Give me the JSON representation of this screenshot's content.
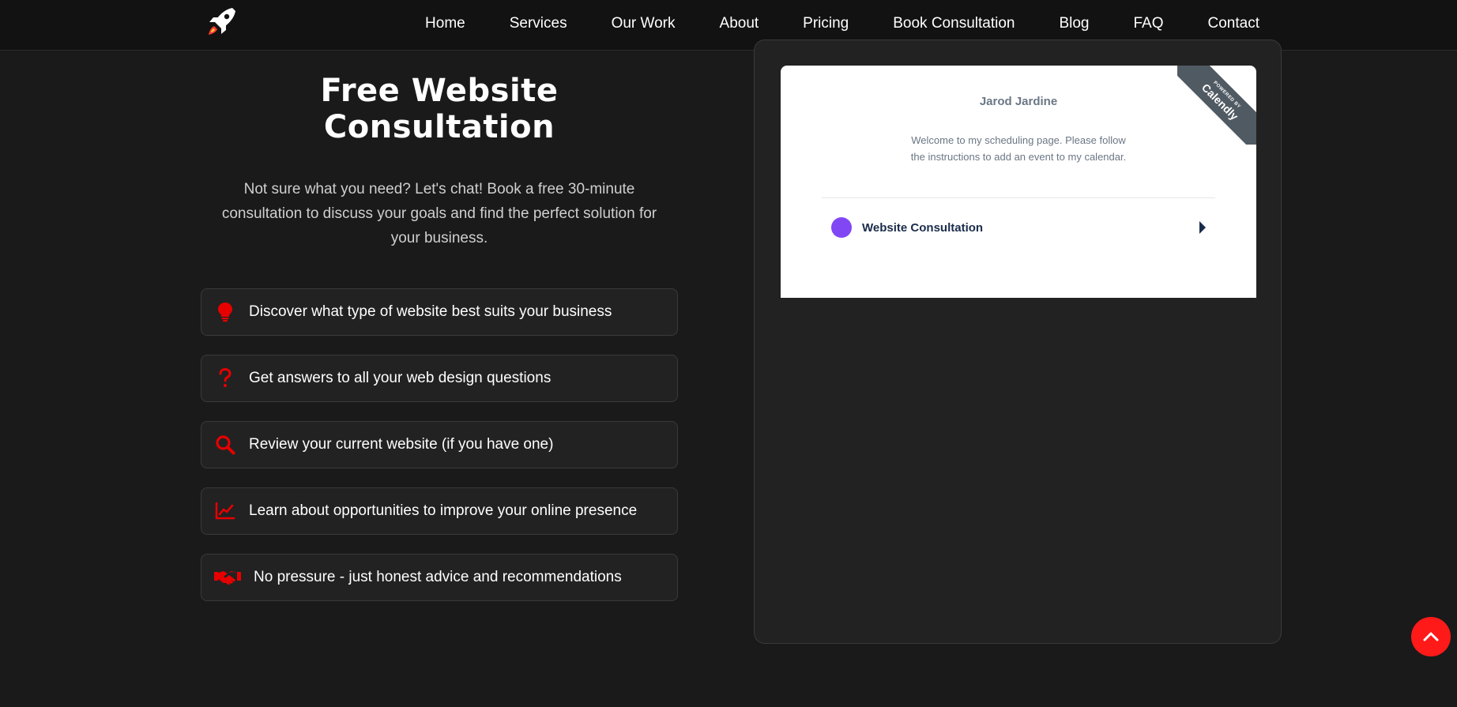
{
  "nav": {
    "logo_icon": "rocket-icon",
    "links": [
      "Home",
      "Services",
      "Our Work",
      "About",
      "Pricing",
      "Book Consultation",
      "Blog",
      "FAQ",
      "Contact"
    ]
  },
  "hero": {
    "title": "Free Website Consultation",
    "description": "Not sure what you need? Let's chat! Book a free 30-minute consultation to discuss your goals and find the perfect solution for your business."
  },
  "features": [
    {
      "icon": "lightbulb-icon",
      "text": "Discover what type of website best suits your business"
    },
    {
      "icon": "question-icon",
      "text": "Get answers to all your web design questions"
    },
    {
      "icon": "search-icon",
      "text": "Review your current website (if you have one)"
    },
    {
      "icon": "chart-line-icon",
      "text": "Learn about opportunities to improve your online presence"
    },
    {
      "icon": "handshake-icon",
      "text": "No pressure - just honest advice and recommendations"
    }
  ],
  "calendly": {
    "ribbon_small": "POWERED BY",
    "ribbon_brand": "Calendly",
    "host_name": "Jarod Jardine",
    "welcome": "Welcome to my scheduling page. Please follow the instructions to add an event to my calendar.",
    "event_name": "Website Consultation",
    "event_color": "#8247f5"
  },
  "colors": {
    "accent": "#ff1a1a",
    "background": "#1a1a1a",
    "card": "#222222"
  }
}
